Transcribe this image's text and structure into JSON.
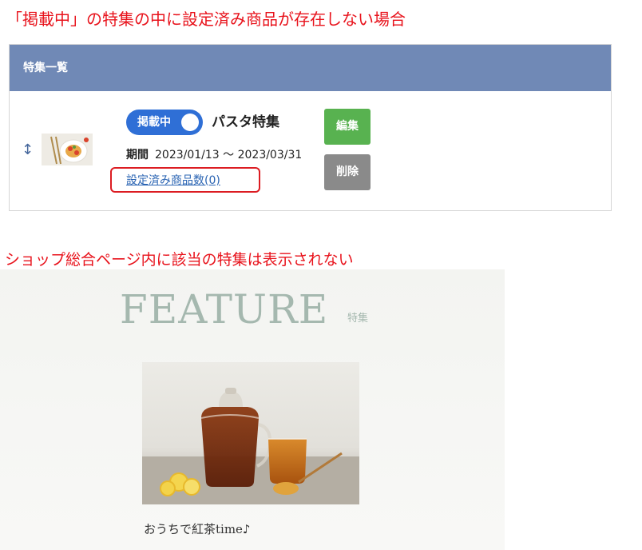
{
  "captions": {
    "top": "「掲載中」の特集の中に設定済み商品が存在しない場合",
    "bottom": "ショップ総合ページ内に該当の特集は表示されない"
  },
  "admin": {
    "header_title": "特集一覧",
    "row": {
      "sort_icon": "sort-arrows-icon",
      "status": "掲載中",
      "name": "パスタ特集",
      "period_label": "期間",
      "period_value": "2023/01/13 ～ 2023/03/31",
      "product_count_link": "設定済み商品数(0)",
      "edit_label": "編集",
      "delete_label": "削除"
    }
  },
  "shop": {
    "heading": "FEATURE",
    "heading_sub": "特集",
    "card_title": "おうちで紅茶time♪"
  },
  "colors": {
    "caption": "#e8121b",
    "header_bg": "#7089b6",
    "toggle": "#2f6fd6",
    "edit": "#58b250",
    "delete": "#8a8a8a",
    "highlight": "#dc1c22",
    "feature_heading": "#a5b8af"
  }
}
